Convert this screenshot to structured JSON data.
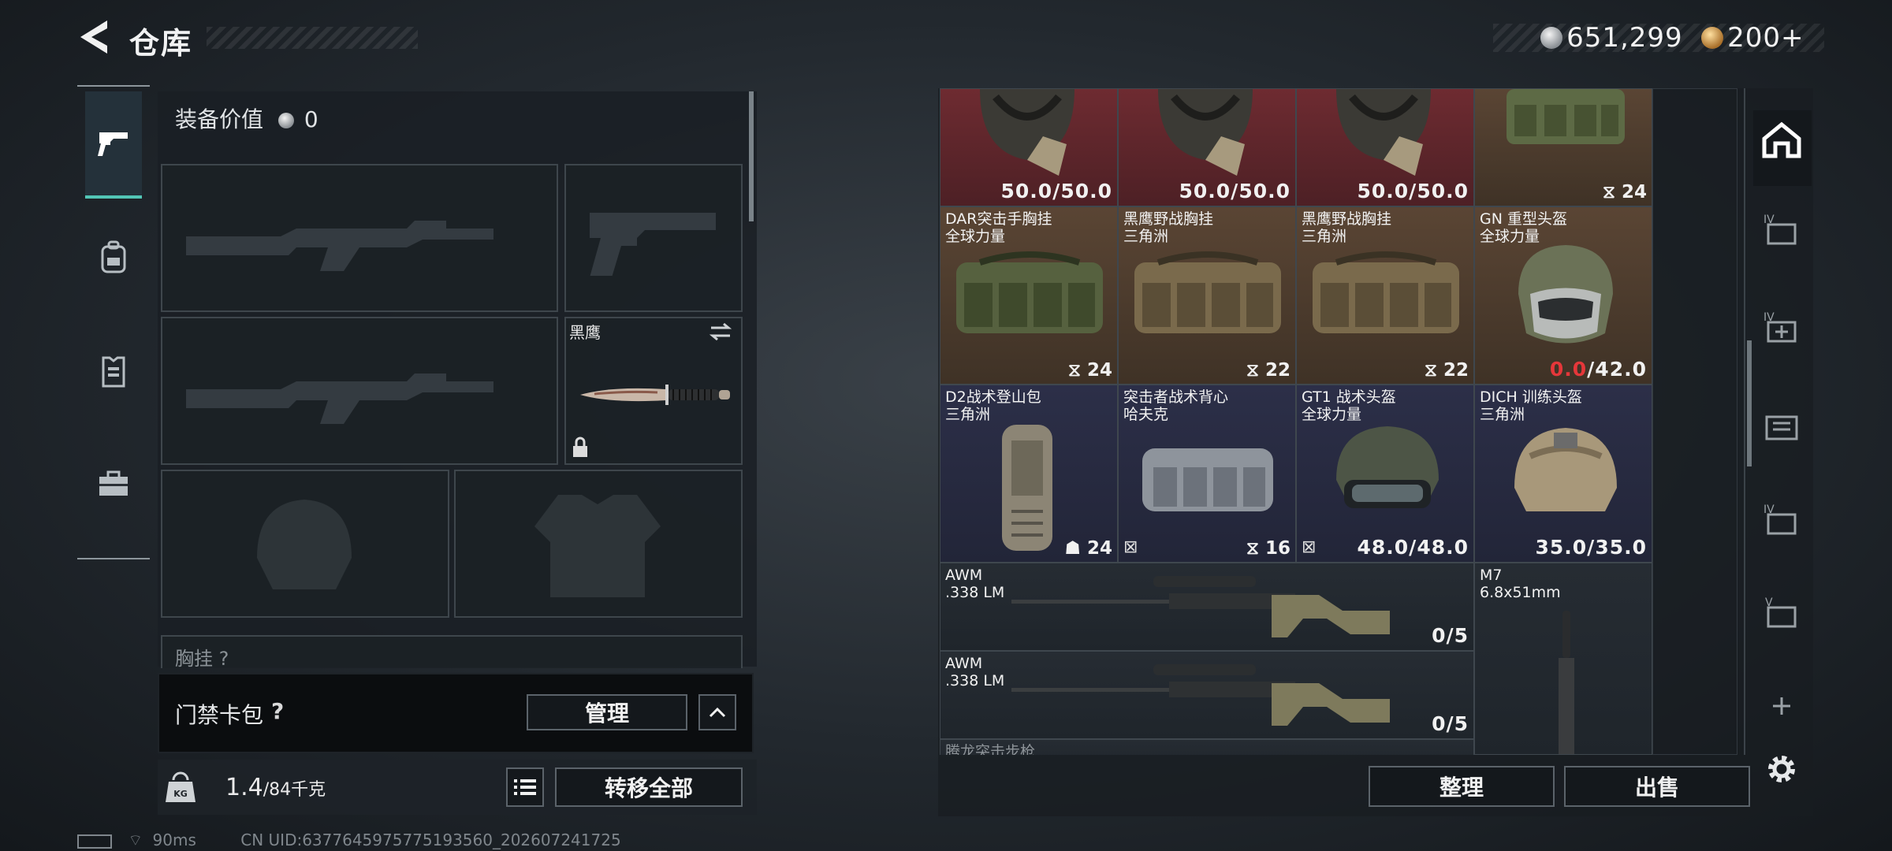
{
  "header": {
    "title": "仓库",
    "currency_silver": "651,299",
    "currency_gold": "200+"
  },
  "nav": {
    "items": [
      "weapons",
      "backpack",
      "armor",
      "tools"
    ],
    "active": "weapons"
  },
  "loadout": {
    "equip_value_label": "装备价值",
    "equip_value": "0",
    "knife_name": "黑鹰",
    "chest_label": "胸挂 ?"
  },
  "keycard": {
    "label": "门禁卡包",
    "help": "?",
    "manage_label": "管理"
  },
  "bottom": {
    "weight_value": "1.4",
    "weight_max": "/84千克",
    "transfer_all_label": "转移全部",
    "sort_label": "整理",
    "sell_label": "出售"
  },
  "status": {
    "ping": "90ms",
    "uid": "CN UID:6377645975775193560_202607241725"
  },
  "stash": {
    "row1": [
      {
        "durability": "50.0/50.0"
      },
      {
        "durability": "50.0/50.0"
      },
      {
        "durability": "50.0/50.0"
      },
      {
        "capacity": "24"
      }
    ],
    "row2": [
      {
        "name": "DAR突击手胸挂",
        "faction": "全球力量",
        "capacity": "24"
      },
      {
        "name": "黑鹰野战胸挂",
        "faction": "三角洲",
        "capacity": "22"
      },
      {
        "name": "黑鹰野战胸挂",
        "faction": "三角洲",
        "capacity": "22"
      },
      {
        "name": "GN 重型头盔",
        "faction": "全球力量",
        "dur_current": "0.0",
        "dur_max": "/42.0"
      }
    ],
    "row3": [
      {
        "name": "D2战术登山包",
        "faction": "三角洲",
        "capacity": "24"
      },
      {
        "name": "突击者战术背心",
        "faction": "哈夫克",
        "capacity": "16"
      },
      {
        "name": "GT1 战术头盔",
        "faction": "全球力量",
        "durability": "48.0/48.0"
      },
      {
        "name": "DICH 训练头盔",
        "faction": "三角洲",
        "durability": "35.0/35.0"
      }
    ],
    "rifle1": {
      "name": "AWM",
      "caliber": ".338 LM",
      "ammo": "0/5"
    },
    "rifle2": {
      "name": "AWM",
      "caliber": ".338 LM",
      "ammo": "0/5"
    },
    "m7": {
      "name": "M7",
      "caliber": "6.8x51mm"
    },
    "next_label": "腾龙突击步枪"
  }
}
